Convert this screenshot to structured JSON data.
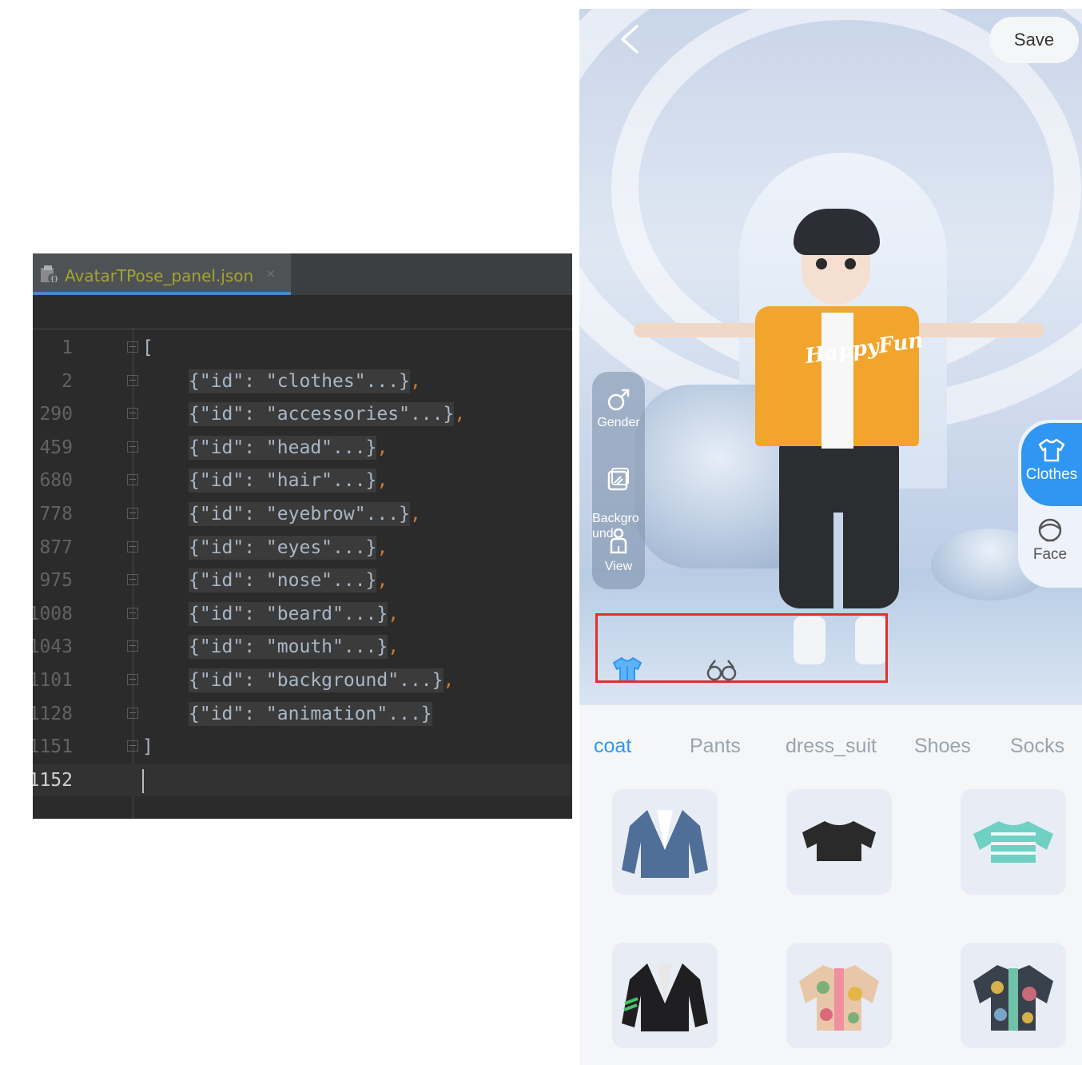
{
  "editor": {
    "tab_title": "AvatarTPose_panel.json",
    "tab_close": "×",
    "lines": [
      {
        "number": "1",
        "text": "[",
        "comma": false,
        "plain": true
      },
      {
        "number": "2",
        "text": "{\"id\": \"clothes\"...}",
        "comma": true,
        "plain": false
      },
      {
        "number": "290",
        "text": "{\"id\": \"accessories\"...}",
        "comma": true,
        "plain": false
      },
      {
        "number": "459",
        "text": "{\"id\": \"head\"...}",
        "comma": true,
        "plain": false
      },
      {
        "number": "680",
        "text": "{\"id\": \"hair\"...}",
        "comma": true,
        "plain": false
      },
      {
        "number": "778",
        "text": "{\"id\": \"eyebrow\"...}",
        "comma": true,
        "plain": false
      },
      {
        "number": "877",
        "text": "{\"id\": \"eyes\"...}",
        "comma": true,
        "plain": false
      },
      {
        "number": "975",
        "text": "{\"id\": \"nose\"...}",
        "comma": true,
        "plain": false
      },
      {
        "number": "1008",
        "text": "{\"id\": \"beard\"...}",
        "comma": true,
        "plain": false
      },
      {
        "number": "1043",
        "text": "{\"id\": \"mouth\"...}",
        "comma": true,
        "plain": false
      },
      {
        "number": "1101",
        "text": "{\"id\": \"background\"...}",
        "comma": true,
        "plain": false
      },
      {
        "number": "1128",
        "text": "{\"id\": \"animation\"...}",
        "comma": false,
        "plain": false
      },
      {
        "number": "1151",
        "text": "]",
        "comma": false,
        "plain": true
      },
      {
        "number": "1152",
        "text": "",
        "comma": false,
        "plain": true
      }
    ],
    "comma": ","
  },
  "app": {
    "save_label": "Save",
    "shirt_print": "HappyFun",
    "left_panel": {
      "gender": "Gender",
      "background": "Backgro\nund",
      "view": "View"
    },
    "right_panel": {
      "clothes": "Clothes",
      "face": "Face"
    },
    "category_icons": [
      "tshirt-icon",
      "glasses-icon"
    ],
    "subtabs": [
      "coat",
      "Pants",
      "dress_suit",
      "Shoes",
      "Socks"
    ],
    "active_subtab": "coat",
    "items": [
      {
        "name": "blue-blazer",
        "color": "#4f6f99"
      },
      {
        "name": "black-crop-tee",
        "color": "#2a2a2a"
      },
      {
        "name": "striped-crop-tee",
        "color": "#6fd0c4"
      },
      {
        "name": "black-racing-jacket",
        "color": "#1f1f22"
      },
      {
        "name": "floral-shirt-light",
        "color": "#e8c7a8"
      },
      {
        "name": "floral-shirt-dark",
        "color": "#39424c"
      }
    ],
    "accent_color": "#2f96f3"
  }
}
